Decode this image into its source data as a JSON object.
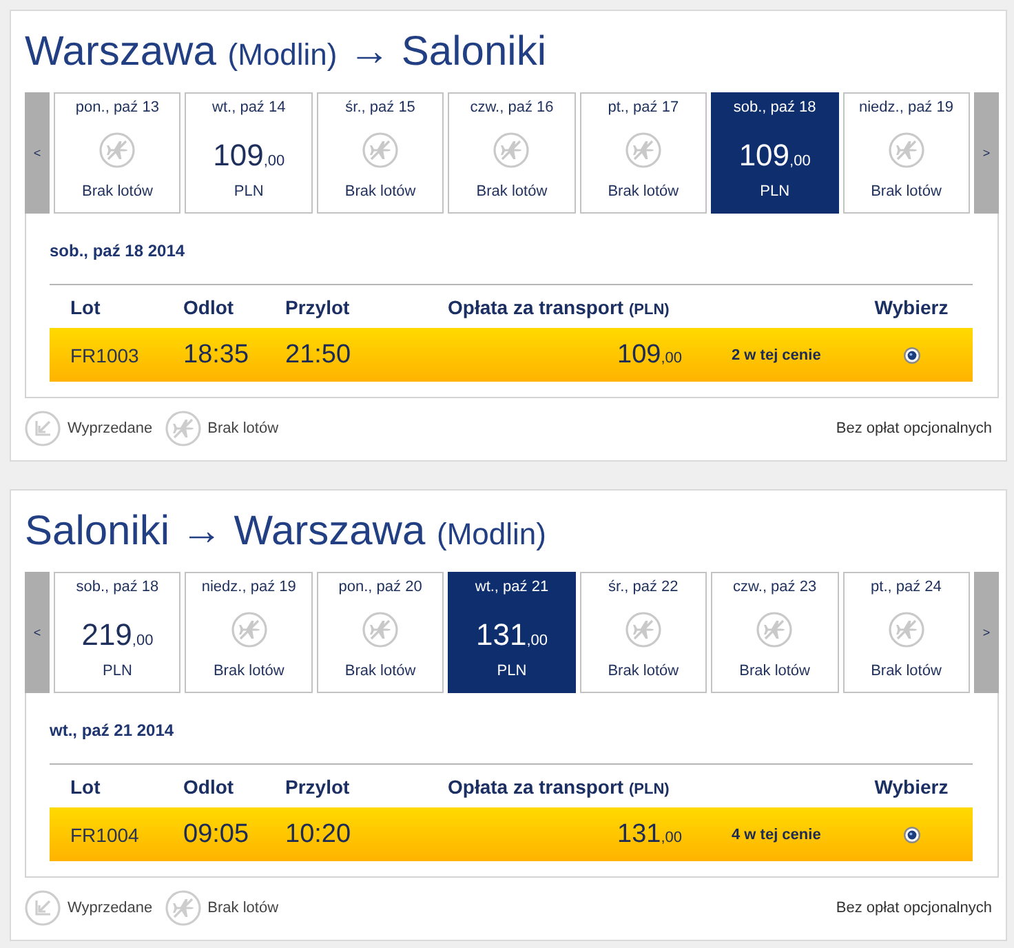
{
  "journeys": [
    {
      "title": [
        {
          "kind": "city",
          "text": "Warszawa"
        },
        {
          "kind": "airport",
          "text": "(Modlin)"
        },
        {
          "kind": "arrow",
          "text": "→"
        },
        {
          "kind": "city",
          "text": "Saloniki"
        }
      ],
      "prev_button": "<",
      "next_button": ">",
      "days": [
        {
          "date": "pon., paź 13",
          "kind": "no_flights",
          "label": "Brak lotów",
          "selected": false
        },
        {
          "date": "wt., paź 14",
          "kind": "fare",
          "price": "109",
          "cents": ",00",
          "currency": "PLN",
          "selected": false
        },
        {
          "date": "śr., paź 15",
          "kind": "no_flights",
          "label": "Brak lotów",
          "selected": false
        },
        {
          "date": "czw., paź 16",
          "kind": "no_flights",
          "label": "Brak lotów",
          "selected": false
        },
        {
          "date": "pt., paź 17",
          "kind": "no_flights",
          "label": "Brak lotów",
          "selected": false
        },
        {
          "date": "sob., paź 18",
          "kind": "fare",
          "price": "109",
          "cents": ",00",
          "currency": "PLN",
          "selected": true
        },
        {
          "date": "niedz., paź 19",
          "kind": "no_flights",
          "label": "Brak lotów",
          "selected": false
        }
      ],
      "selected_date": "sob., paź 18 2014",
      "columns": [
        {
          "label": "Lot"
        },
        {
          "label": "Odlot"
        },
        {
          "label": "Przylot"
        },
        {
          "label": "Opłata za transport",
          "unit": "(PLN)"
        },
        {
          "label": "Wybierz"
        }
      ],
      "flights": [
        {
          "number": "FR1003",
          "departure": "18:35",
          "arrival": "21:50",
          "price": "109",
          "cents": ",00",
          "note": "2 w tej cenie",
          "selected": true
        }
      ],
      "legend": [
        {
          "kind": "sold_out",
          "label": "Wyprzedane"
        },
        {
          "kind": "no_flights",
          "label": "Brak lotów"
        }
      ],
      "fee_note": "Bez opłat opcjonalnych"
    },
    {
      "title": [
        {
          "kind": "city",
          "text": "Saloniki"
        },
        {
          "kind": "arrow",
          "text": "→"
        },
        {
          "kind": "city",
          "text": "Warszawa"
        },
        {
          "kind": "airport",
          "text": "(Modlin)"
        }
      ],
      "prev_button": "<",
      "next_button": ">",
      "days": [
        {
          "date": "sob., paź 18",
          "kind": "fare",
          "price": "219",
          "cents": ",00",
          "currency": "PLN",
          "selected": false
        },
        {
          "date": "niedz., paź 19",
          "kind": "no_flights",
          "label": "Brak lotów",
          "selected": false
        },
        {
          "date": "pon., paź 20",
          "kind": "no_flights",
          "label": "Brak lotów",
          "selected": false
        },
        {
          "date": "wt., paź 21",
          "kind": "fare",
          "price": "131",
          "cents": ",00",
          "currency": "PLN",
          "selected": true
        },
        {
          "date": "śr., paź 22",
          "kind": "no_flights",
          "label": "Brak lotów",
          "selected": false
        },
        {
          "date": "czw., paź 23",
          "kind": "no_flights",
          "label": "Brak lotów",
          "selected": false
        },
        {
          "date": "pt., paź 24",
          "kind": "no_flights",
          "label": "Brak lotów",
          "selected": false
        }
      ],
      "selected_date": "wt., paź 21 2014",
      "columns": [
        {
          "label": "Lot"
        },
        {
          "label": "Odlot"
        },
        {
          "label": "Przylot"
        },
        {
          "label": "Opłata za transport",
          "unit": "(PLN)"
        },
        {
          "label": "Wybierz"
        }
      ],
      "flights": [
        {
          "number": "FR1004",
          "departure": "09:05",
          "arrival": "10:20",
          "price": "131",
          "cents": ",00",
          "note": "4 w tej cenie",
          "selected": true
        }
      ],
      "legend": [
        {
          "kind": "sold_out",
          "label": "Wyprzedane"
        },
        {
          "kind": "no_flights",
          "label": "Brak lotów"
        }
      ],
      "fee_note": "Bez opłat opcjonalnych"
    }
  ]
}
